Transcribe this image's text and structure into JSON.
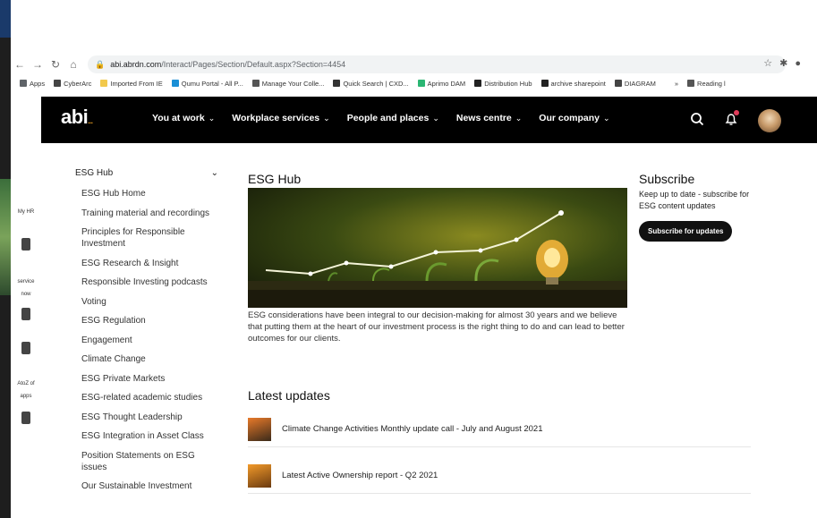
{
  "browser": {
    "url_domain": "abi.abrdn.com",
    "url_path": "/Interact/Pages/Section/Default.aspx?Section=4454",
    "bookmarks": [
      {
        "label": "Apps",
        "color": "#5f6368"
      },
      {
        "label": "CyberArc",
        "color": "#444444"
      },
      {
        "label": "Imported From IE",
        "color": "#f2c94c"
      },
      {
        "label": "Qumu Portal - All P...",
        "color": "#1a8fd6"
      },
      {
        "label": "Manage Your Colle...",
        "color": "#555555"
      },
      {
        "label": "Quick Search | CXD...",
        "color": "#333333"
      },
      {
        "label": "Aprimo DAM",
        "color": "#2bb673"
      },
      {
        "label": "Distribution Hub",
        "color": "#222222"
      },
      {
        "label": "archive sharepoint",
        "color": "#222222"
      },
      {
        "label": "DIAGRAM",
        "color": "#444444"
      },
      {
        "label": "»",
        "color": "#ffffff"
      },
      {
        "label": "Reading l",
        "color": "#555555"
      }
    ]
  },
  "rail": [
    "My HR",
    "",
    "service now",
    "",
    "",
    "AtoZ of apps",
    ""
  ],
  "header": {
    "logo": "abi",
    "logo_suffix": "...",
    "menu": [
      {
        "label": "You at work"
      },
      {
        "label": "Workplace services"
      },
      {
        "label": "People and places"
      },
      {
        "label": "News centre"
      },
      {
        "label": "Our company"
      }
    ]
  },
  "leftnav": {
    "title": "ESG Hub",
    "items": [
      "ESG Hub Home",
      "Training material and recordings",
      "Principles for Responsible Investment",
      "ESG Research & Insight",
      "Responsible Investing podcasts",
      "Voting",
      "ESG Regulation",
      "Engagement",
      "Climate Change",
      "ESG Private Markets",
      "ESG-related academic studies",
      "ESG Thought Leadership",
      "ESG Integration in Asset Class",
      "Position Statements on ESG issues",
      "Our Sustainable Investment"
    ]
  },
  "main": {
    "title": "ESG Hub",
    "intro": "ESG considerations have been integral to our decision-making for almost 30 years and we believe that putting them at the heart of our investment process is the right thing to do and can lead to better outcomes for our clients.",
    "latest_title": "Latest updates",
    "updates": [
      {
        "title": "Climate Change Activities Monthly update call - July and August 2021"
      },
      {
        "title": "Latest Active Ownership report - Q2 2021"
      }
    ]
  },
  "subscribe": {
    "title": "Subscribe",
    "text": "Keep up to date - subscribe for ESG content updates",
    "button": "Subscribe for updates"
  }
}
